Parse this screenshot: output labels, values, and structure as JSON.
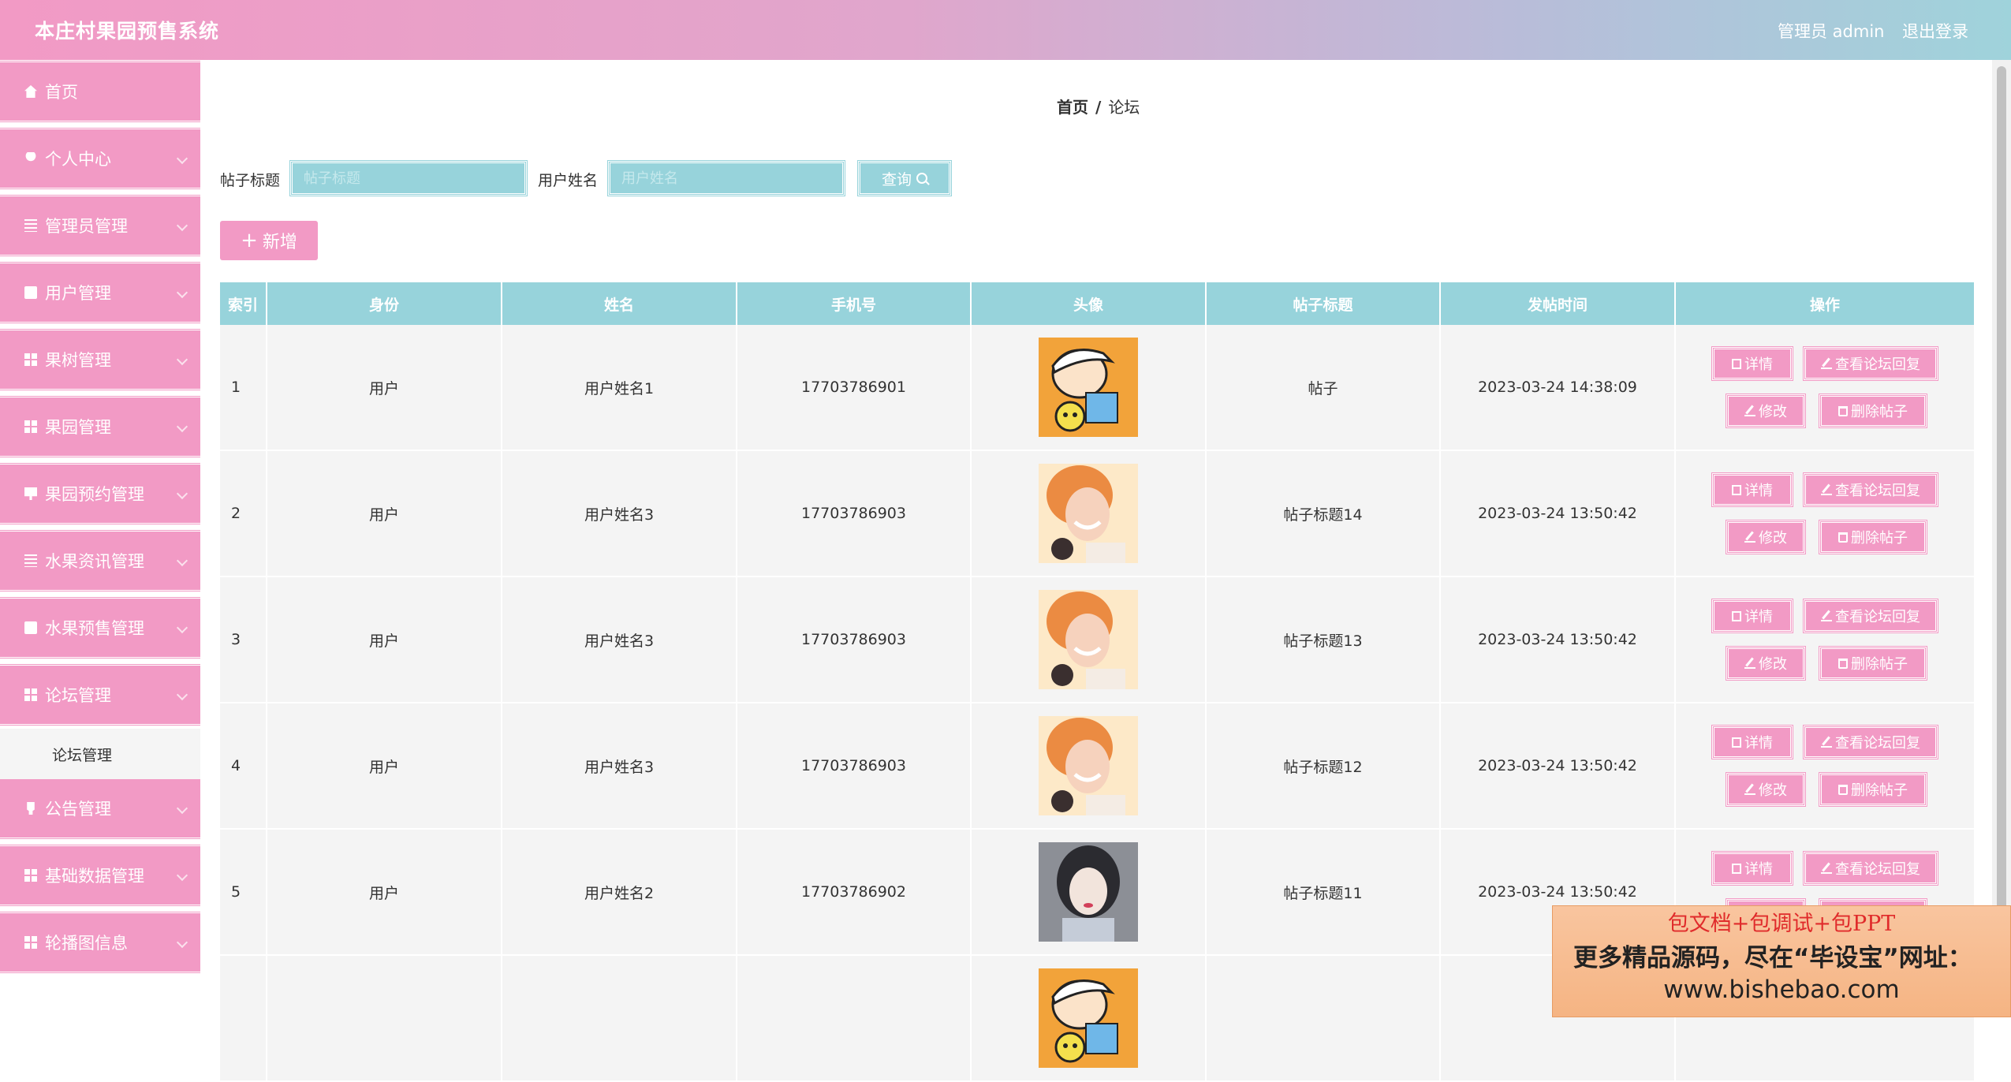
{
  "header": {
    "app_title": "本庄村果园预售系统",
    "admin_label": "管理员 admin",
    "logout_label": "退出登录"
  },
  "sidebar": {
    "items": [
      {
        "label": "首页",
        "icon": "home-icon",
        "expandable": false
      },
      {
        "label": "个人中心",
        "icon": "user-icon",
        "expandable": true
      },
      {
        "label": "管理员管理",
        "icon": "list-icon",
        "expandable": true
      },
      {
        "label": "用户管理",
        "icon": "box-icon",
        "expandable": true
      },
      {
        "label": "果树管理",
        "icon": "bar-chart-icon",
        "expandable": true
      },
      {
        "label": "果园管理",
        "icon": "grid-icon",
        "expandable": true
      },
      {
        "label": "果园预约管理",
        "icon": "monitor-icon",
        "expandable": true
      },
      {
        "label": "水果资讯管理",
        "icon": "list-icon",
        "expandable": true
      },
      {
        "label": "水果预售管理",
        "icon": "box-icon",
        "expandable": true
      },
      {
        "label": "论坛管理",
        "icon": "grid-icon",
        "expandable": true
      },
      {
        "label": "公告管理",
        "icon": "bulb-icon",
        "expandable": true
      },
      {
        "label": "基础数据管理",
        "icon": "grid-icon",
        "expandable": true
      },
      {
        "label": "轮播图信息",
        "icon": "grid-icon",
        "expandable": true
      }
    ],
    "sub_item": "论坛管理"
  },
  "breadcrumb": {
    "home": "首页",
    "separator": "/",
    "current": "论坛"
  },
  "search": {
    "title_label": "帖子标题",
    "title_placeholder": "帖子标题",
    "name_label": "用户姓名",
    "name_placeholder": "用户姓名",
    "query_label": "查询"
  },
  "actions": {
    "add_label": "新增"
  },
  "table": {
    "columns": [
      "索引",
      "身份",
      "姓名",
      "手机号",
      "头像",
      "帖子标题",
      "发帖时间",
      "操作"
    ],
    "rows": [
      {
        "index": "1",
        "role": "用户",
        "name": "用户姓名1",
        "phone": "17703786901",
        "avatar": "cartoon-boy",
        "title": "帖子",
        "time": "2023-03-24 14:38:09"
      },
      {
        "index": "2",
        "role": "用户",
        "name": "用户姓名3",
        "phone": "17703786903",
        "avatar": "smiling-girl",
        "title": "帖子标题14",
        "time": "2023-03-24 13:50:42"
      },
      {
        "index": "3",
        "role": "用户",
        "name": "用户姓名3",
        "phone": "17703786903",
        "avatar": "smiling-girl",
        "title": "帖子标题13",
        "time": "2023-03-24 13:50:42"
      },
      {
        "index": "4",
        "role": "用户",
        "name": "用户姓名3",
        "phone": "17703786903",
        "avatar": "smiling-girl",
        "title": "帖子标题12",
        "time": "2023-03-24 13:50:42"
      },
      {
        "index": "5",
        "role": "用户",
        "name": "用户姓名2",
        "phone": "17703786902",
        "avatar": "dark-hair-girl",
        "title": "帖子标题11",
        "time": "2023-03-24 13:50:42"
      },
      {
        "index": "",
        "role": "",
        "name": "",
        "phone": "",
        "avatar": "cartoon-boy",
        "title": "",
        "time": ""
      }
    ],
    "op_labels": {
      "detail": "详情",
      "view_replies": "查看论坛回复",
      "edit": "修改",
      "delete": "删除帖子"
    }
  },
  "watermark": {
    "line1": "包文档+包调试+包PPT",
    "line2": "更多精品源码，尽在“毕设宝”网址：",
    "line3": "www.bishebao.com"
  },
  "colors": {
    "pink": "#f29ac5",
    "teal": "#97d3db",
    "row_bg": "#f4f4f4"
  }
}
